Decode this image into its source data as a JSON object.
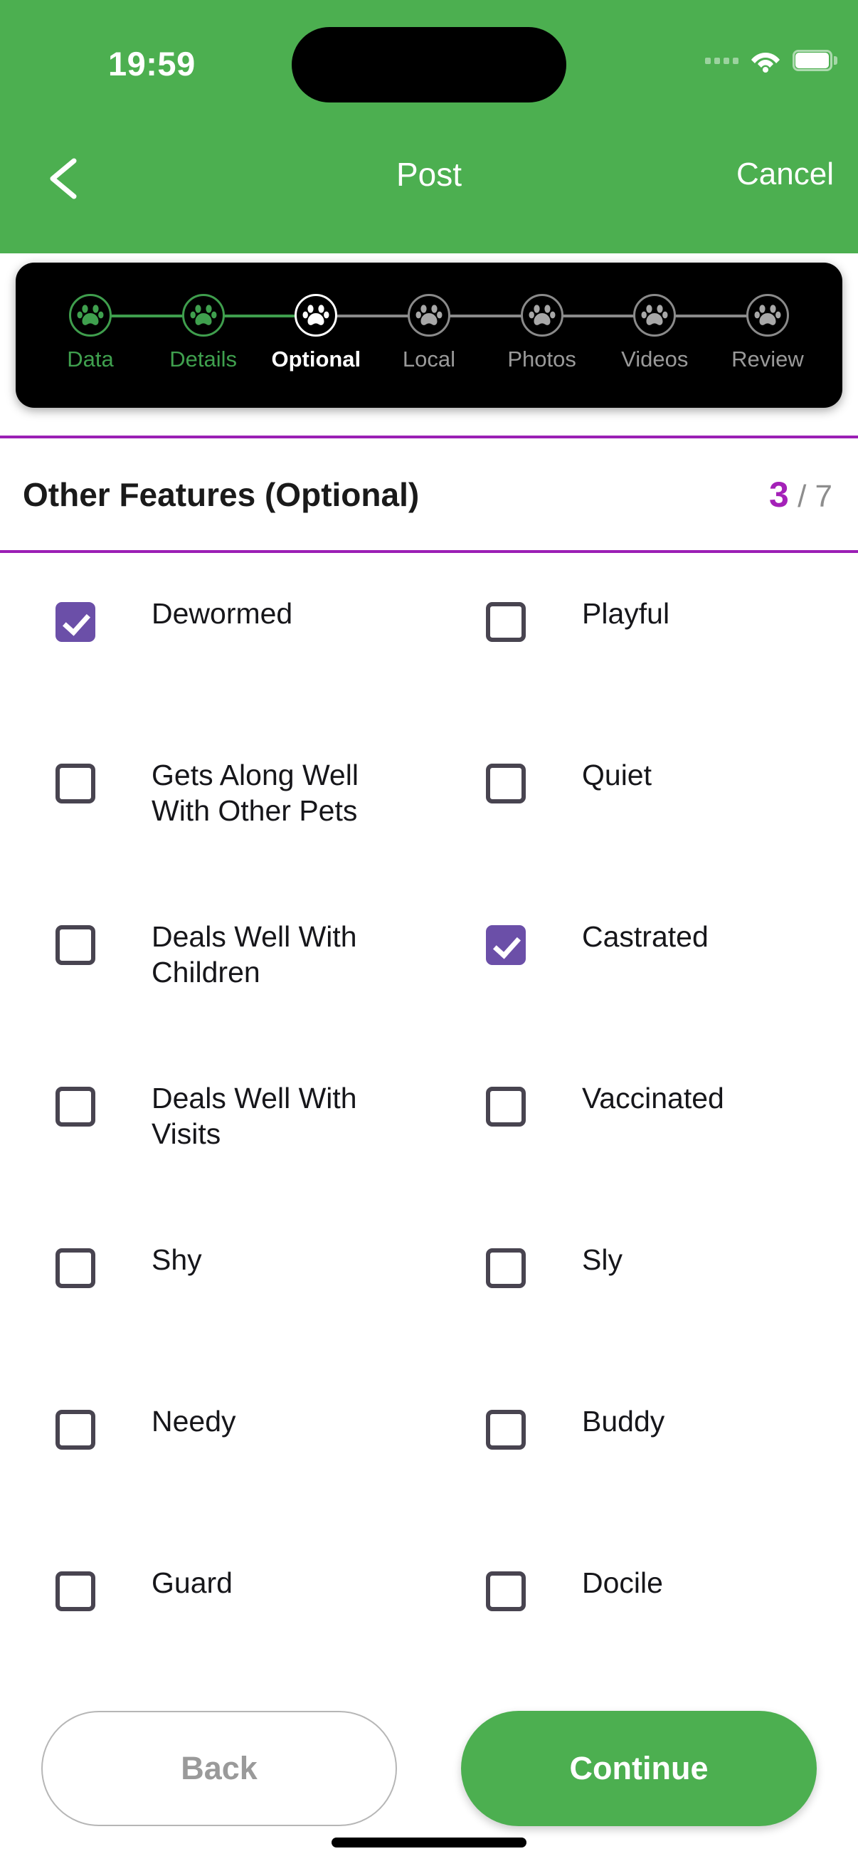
{
  "statusbar": {
    "time": "19:59",
    "wifi_icon": "wifi-icon",
    "battery_icon": "battery-icon",
    "signal_icon": "signal-dots-icon"
  },
  "navbar": {
    "back_icon": "chevron-left-icon",
    "title": "Post",
    "cancel_label": "Cancel"
  },
  "stepper": {
    "steps": [
      {
        "label": "Data",
        "state": "done",
        "icon": "paw-icon"
      },
      {
        "label": "Details",
        "state": "done",
        "icon": "paw-icon"
      },
      {
        "label": "Optional",
        "state": "current",
        "icon": "paw-icon"
      },
      {
        "label": "Local",
        "state": "todo",
        "icon": "paw-icon"
      },
      {
        "label": "Photos",
        "state": "todo",
        "icon": "paw-icon"
      },
      {
        "label": "Videos",
        "state": "todo",
        "icon": "paw-icon"
      },
      {
        "label": "Review",
        "state": "todo",
        "icon": "paw-icon"
      }
    ]
  },
  "section": {
    "title": "Other Features (Optional)",
    "current_step": "3",
    "total_steps": "/ 7",
    "accent_color": "#a421b8"
  },
  "features": {
    "rows": [
      {
        "left": {
          "label": "Dewormed",
          "checked": true
        },
        "right": {
          "label": "Playful",
          "checked": false
        }
      },
      {
        "left": {
          "label": "Gets Along Well With Other Pets",
          "checked": false
        },
        "right": {
          "label": "Quiet",
          "checked": false
        }
      },
      {
        "left": {
          "label": "Deals Well With Children",
          "checked": false
        },
        "right": {
          "label": "Castrated",
          "checked": true
        }
      },
      {
        "left": {
          "label": "Deals Well With Visits",
          "checked": false
        },
        "right": {
          "label": "Vaccinated",
          "checked": false
        }
      },
      {
        "left": {
          "label": "Shy",
          "checked": false
        },
        "right": {
          "label": "Sly",
          "checked": false
        }
      },
      {
        "left": {
          "label": "Needy",
          "checked": false
        },
        "right": {
          "label": "Buddy",
          "checked": false
        }
      },
      {
        "left": {
          "label": "Guard",
          "checked": false
        },
        "right": {
          "label": "Docile",
          "checked": false
        }
      }
    ]
  },
  "footer": {
    "back_label": "Back",
    "continue_label": "Continue"
  },
  "colors": {
    "header_green": "#4CAF50",
    "checkbox_purple": "#6b4fa8",
    "divider_purple": "#9b1fb5",
    "step_done_green": "#3fa04e"
  }
}
